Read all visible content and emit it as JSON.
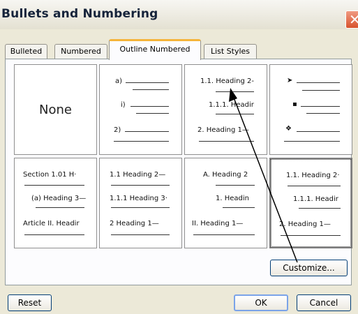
{
  "dialog": {
    "title": "Bullets and Numbering"
  },
  "tabs": [
    {
      "label": "Bulleted",
      "active": false
    },
    {
      "label": "Numbered",
      "active": false
    },
    {
      "label": "Outline Numbered",
      "active": true
    },
    {
      "label": "List Styles",
      "active": false
    }
  ],
  "options": {
    "none": {
      "label": "None"
    },
    "alpha_paren": {
      "rows": [
        "a)",
        "i)",
        "2)"
      ]
    },
    "heading_outline": {
      "rows": [
        "1.1. Heading 2-",
        "1.1.1. Headir",
        "2. Heading 1—"
      ]
    },
    "bullets": {
      "rows": [
        "➤",
        "▪",
        "❖"
      ]
    },
    "section_article": {
      "rows": [
        "Section 1.01 H·",
        "(a) Heading 3—",
        "Article II. Headir"
      ]
    },
    "heading_plain": {
      "rows": [
        "1.1 Heading 2—",
        "1.1.1 Heading 3·",
        "2 Heading 1—"
      ]
    },
    "alpha_roman": {
      "rows": [
        "A. Heading 2",
        "1. Headin",
        "II. Heading 1—"
      ]
    },
    "heading_selected": {
      "rows": [
        "1.1. Heading 2·",
        "1.1.1. Headir",
        "2. Heading 1—"
      ]
    }
  },
  "buttons": {
    "customize": "Customize...",
    "reset": "Reset",
    "ok": "OK",
    "cancel": "Cancel"
  },
  "colors": {
    "dialog_bg": "#ece9d8",
    "active_tab_accent": "#f5b43a",
    "close_button": "#d8532d",
    "ok_focus": "#7aa3e8"
  }
}
